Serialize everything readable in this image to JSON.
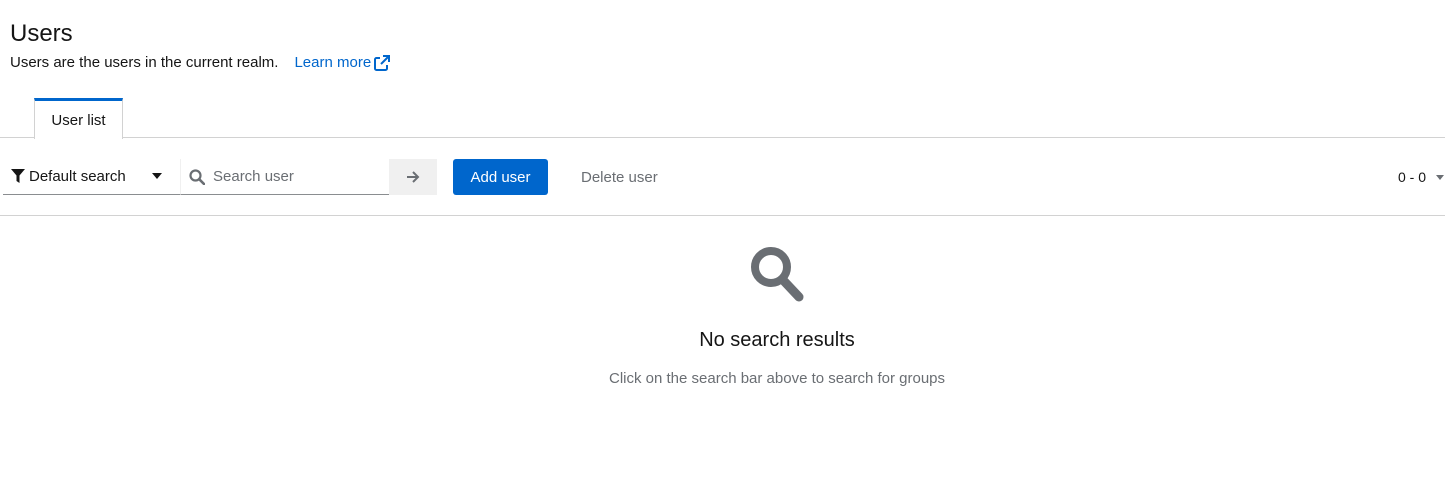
{
  "header": {
    "title": "Users",
    "subtitle": "Users are the users in the current realm.",
    "learn_more": "Learn more"
  },
  "tabs": [
    {
      "label": "User list",
      "active": true
    }
  ],
  "toolbar": {
    "filter_label": "Default search",
    "search_placeholder": "Search user",
    "add_user_label": "Add user",
    "delete_user_label": "Delete user",
    "pagination_label": "0 - 0"
  },
  "empty_state": {
    "icon": "search-icon",
    "title": "No search results",
    "body": "Click on the search bar above to search for groups"
  },
  "colors": {
    "primary": "#0066cc",
    "text": "#151515",
    "muted": "#6a6e73",
    "border": "#d2d2d2",
    "icon_gray": "#6a6e73"
  }
}
